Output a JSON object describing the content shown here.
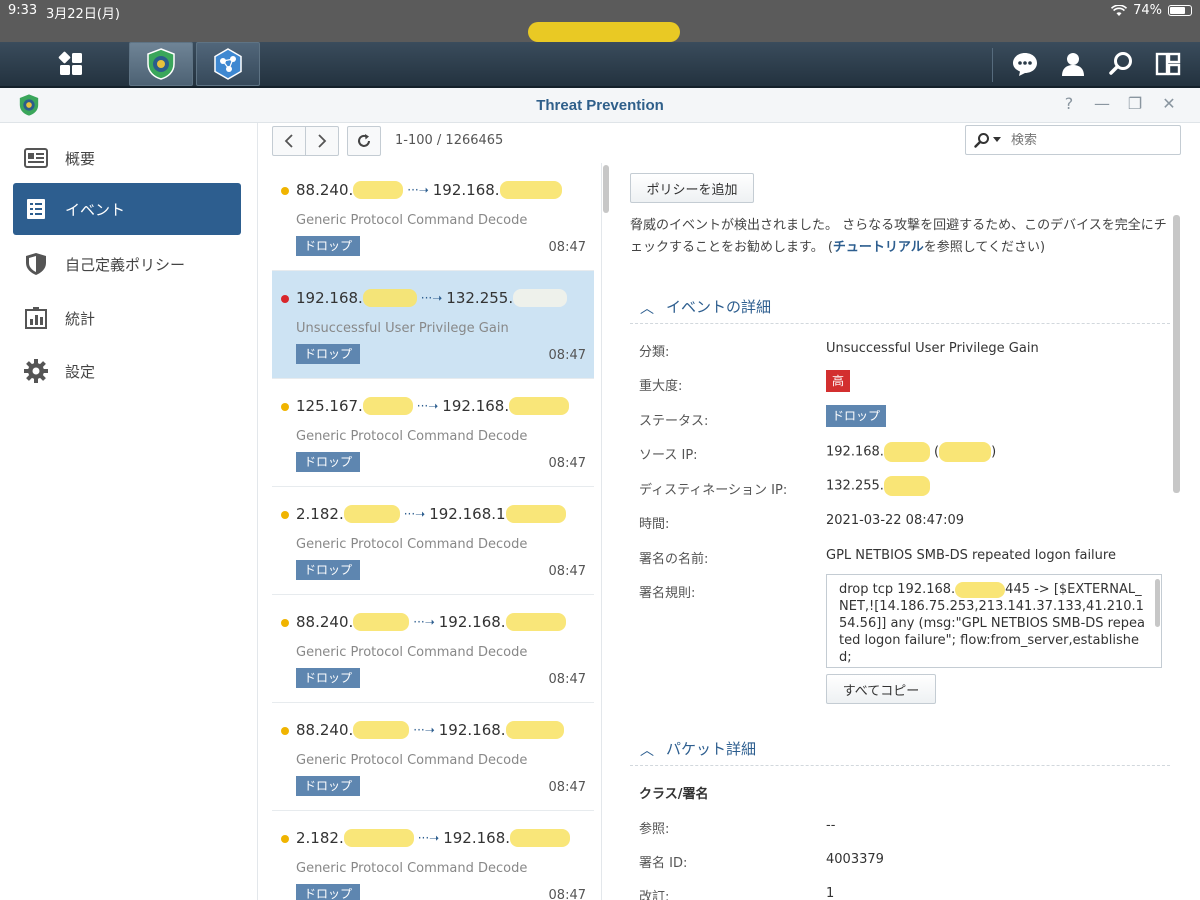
{
  "status_bar": {
    "time": "9:33",
    "date": "3月22日(月)",
    "battery": "74%",
    "battery_level": 0.74
  },
  "window": {
    "title": "Threat Prevention"
  },
  "sidebar": {
    "items": [
      {
        "label": "概要",
        "icon": "overview-icon"
      },
      {
        "label": "イベント",
        "icon": "events-icon"
      },
      {
        "label": "自己定義ポリシー",
        "icon": "shield-icon"
      },
      {
        "label": "統計",
        "icon": "statistics-icon"
      },
      {
        "label": "設定",
        "icon": "gear-icon"
      }
    ]
  },
  "list_toolbar": {
    "count": "1-100 / 1266465",
    "search_placeholder": "検索"
  },
  "events": [
    {
      "src": "88.240.",
      "dst": "192.168.",
      "signature": "Generic Protocol Command Decode",
      "tag": "ドロップ",
      "time": "08:47"
    },
    {
      "src": "192.168.",
      "dst": "132.255.",
      "signature": "Unsuccessful User Privilege Gain",
      "tag": "ドロップ",
      "time": "08:47"
    },
    {
      "src": "125.167.",
      "dst": "192.168.",
      "signature": "Generic Protocol Command Decode",
      "tag": "ドロップ",
      "time": "08:47"
    },
    {
      "src": "2.182.",
      "dst": "192.168.1",
      "signature": "Generic Protocol Command Decode",
      "tag": "ドロップ",
      "time": "08:47"
    },
    {
      "src": "88.240.",
      "dst": "192.168.",
      "signature": "Generic Protocol Command Decode",
      "tag": "ドロップ",
      "time": "08:47"
    },
    {
      "src": "88.240.",
      "dst": "192.168.",
      "signature": "Generic Protocol Command Decode",
      "tag": "ドロップ",
      "time": "08:47"
    },
    {
      "src": "2.182.",
      "dst": "192.168.",
      "signature": "Generic Protocol Command Decode",
      "tag": "ドロップ",
      "time": "08:47"
    }
  ],
  "detail": {
    "add_policy_label": "ポリシーを追加",
    "description_before": "脅威のイベントが検出されました。 さらなる攻撃を回避するため、このデバイスを完全にチェックすることをお勧めします。 (",
    "description_link": "チュートリアル",
    "description_after": "を参照してください)",
    "event_section_title": "イベントの詳細",
    "category_label": "分類:",
    "category_value": "Unsuccessful User Privilege Gain",
    "severity_label": "重大度:",
    "severity_value": "高",
    "status_label": "ステータス:",
    "status_value": "ドロップ",
    "source_ip_label": "ソース IP:",
    "source_ip_value": "192.168.",
    "dest_ip_label": "ディスティネーション IP:",
    "dest_ip_value": "132.255.",
    "time_label": "時間:",
    "time_value": "2021-03-22 08:47:09",
    "signature_name_label": "署名の名前:",
    "signature_name_value": "GPL NETBIOS SMB-DS repeated logon failure",
    "signature_rule_label": "署名規則:",
    "signature_rule_before": "drop tcp 192.168.",
    "signature_rule_after": "445 -> [$EXTERNAL_NET,![14.186.75.253,213.141.37.133,41.210.154.56]] any (msg:\"GPL NETBIOS SMB-DS repeated logon failure\"; flow:from_server,established;",
    "copy_all_label": "すべてコピー",
    "packet_section_title": "パケット詳細",
    "class_signature_label": "クラス/署名",
    "reference_label": "参照:",
    "reference_value": "--",
    "signature_id_label": "署名 ID:",
    "signature_id_value": "4003379",
    "revision_label": "改訂:",
    "revision_value": "1"
  },
  "colors": {
    "accent": "#2d5e8f",
    "severity_high": "#d32f2f",
    "drop_tag": "#5e86b0",
    "dot_warning": "#f0b400",
    "dot_critical": "#d9262b",
    "selected_row": "#cde3f3"
  }
}
